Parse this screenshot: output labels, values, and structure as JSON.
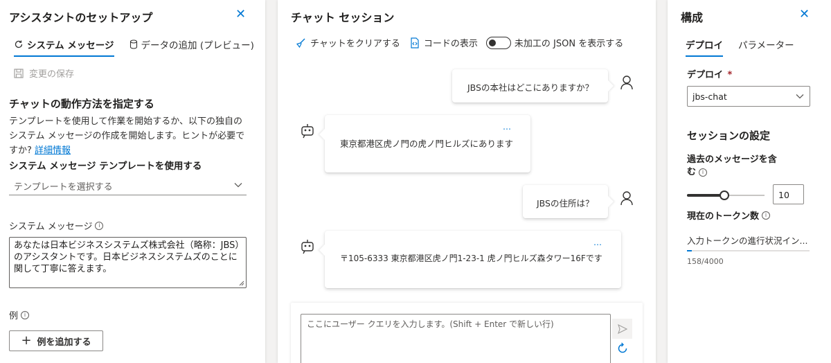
{
  "left": {
    "title": "アシスタントのセットアップ",
    "tabs": [
      {
        "label": "システム メッセージ"
      },
      {
        "label": "データの追加 (プレビュー)"
      }
    ],
    "save_label": "変更の保存",
    "heading": "チャットの動作方法を指定する",
    "desc_lines": [
      "テンプレートを使用して作業を開始するか、以下の独自の",
      "システム メッセージの作成を開始します。ヒントが必要で"
    ],
    "desc_tail": "すか?",
    "details_link": "詳細情報",
    "template_label": "システム メッセージ テンプレートを使用する",
    "template_placeholder": "テンプレートを選択する",
    "sysmsg_label": "システム メッセージ",
    "sysmsg_value": "あなたは日本ビジネスシステムズ株式会社（略称：JBS）のアシスタントです。日本ビジネスシステムズのことに関して丁寧に答えます。",
    "examples_label": "例",
    "add_example_label": "例を追加する"
  },
  "center": {
    "title": "チャット セッション",
    "toolbar": {
      "clear_label": "チャットをクリアする",
      "code_label": "コードの表示",
      "json_label": "未加工の JSON を表示する"
    },
    "messages": [
      {
        "role": "user",
        "text": "JBSの本社はどこにありますか？"
      },
      {
        "role": "assistant",
        "text": "東京都港区虎ノ門の虎ノ門ヒルズにあります"
      },
      {
        "role": "user",
        "text": "JBSの住所は？"
      },
      {
        "role": "assistant",
        "text": "〒105-6333 東京都港区虎ノ門1-23-1 虎ノ門ヒルズ森タワー16Fです"
      }
    ],
    "more_label": "…",
    "input_placeholder": "ここにユーザー クエリを入力します。(Shift + Enter で新しい行)"
  },
  "right": {
    "title": "構成",
    "tabs": [
      {
        "label": "デプロイ"
      },
      {
        "label": "パラメーター"
      }
    ],
    "deploy_label": "デプロイ",
    "required_mark": "*",
    "deploy_value": "jbs-chat",
    "session_heading": "セッションの設定",
    "past_label_1": "過去のメッセージを含",
    "past_label_2": "む",
    "past_value": "10",
    "past_slider_fraction": 0.48,
    "token_label": "現在のトークン数",
    "token_progress_label": "入力トークンの進行状況イン...",
    "token_count": "158/4000",
    "token_fraction": 0.0395
  },
  "colors": {
    "accent": "#0078d4",
    "text": "#323130",
    "muted": "#a19f9d",
    "required": "#a4262c"
  }
}
